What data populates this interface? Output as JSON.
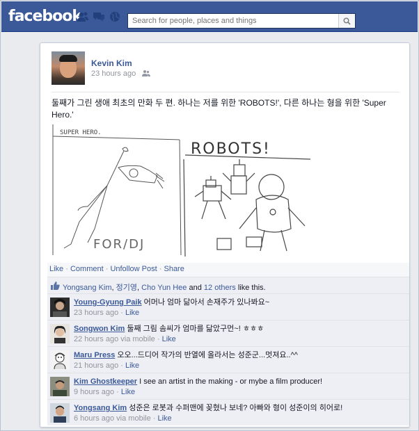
{
  "header": {
    "logo": "facebook",
    "search_placeholder": "Search for people, places and things"
  },
  "post": {
    "author": "Kevin Kim",
    "time": "23 hours ago",
    "text": "둘째가 그린 생애 최초의 만화 두 편. 하나는 저를 위한 'ROBOTS!', 다른 하나는 형을 위한 'Super Hero.'",
    "drawing_labels": {
      "left_title": "SUPER HERO.",
      "left_footer": "FOR/DJ",
      "right_title": "ROBOTS!"
    }
  },
  "actions": {
    "like": "Like",
    "comment": "Comment",
    "unfollow": "Unfollow Post",
    "share": "Share"
  },
  "likes": {
    "names": [
      "Yongsang Kim",
      "정기영",
      "Cho Yun Hee"
    ],
    "and": "and",
    "others": "12 others",
    "suffix": "like this."
  },
  "comments": [
    {
      "name": "Young-Gyung Paik",
      "text": "어머나 엄마 닮아서 손재주가 있나봐요~",
      "time": "23 hours ago",
      "via": "",
      "like": "Like"
    },
    {
      "name": "Songwon Kim",
      "text": "둘째 그림 솜씨가 엄마를 닮았구먼~! ㅎㅎㅎ",
      "time": "22 hours ago",
      "via": "via mobile",
      "like": "Like"
    },
    {
      "name": "Maru Press",
      "text": "오오...드디어 작가의 반열에 올라서는 성준군...멋져요..^^",
      "time": "21 hours ago",
      "via": "",
      "like": "Like"
    },
    {
      "name": "Kim Ghostkeeper",
      "text": "I see an artist in the making - or mybe a film producer!",
      "time": "9 hours ago",
      "via": "",
      "like": "Like"
    },
    {
      "name": "Yongsang Kim",
      "text": "성준은 로봇과 수퍼맨에 꽂혔나 보네? 아빠와 형이 성준이의 히어로!",
      "time": "6 hours ago",
      "via": "via mobile",
      "like": "Like"
    }
  ],
  "colors": {
    "brand": "#3b5998",
    "link": "#3b5998",
    "meta": "#90949c",
    "ufi_bg": "#edeff4"
  }
}
